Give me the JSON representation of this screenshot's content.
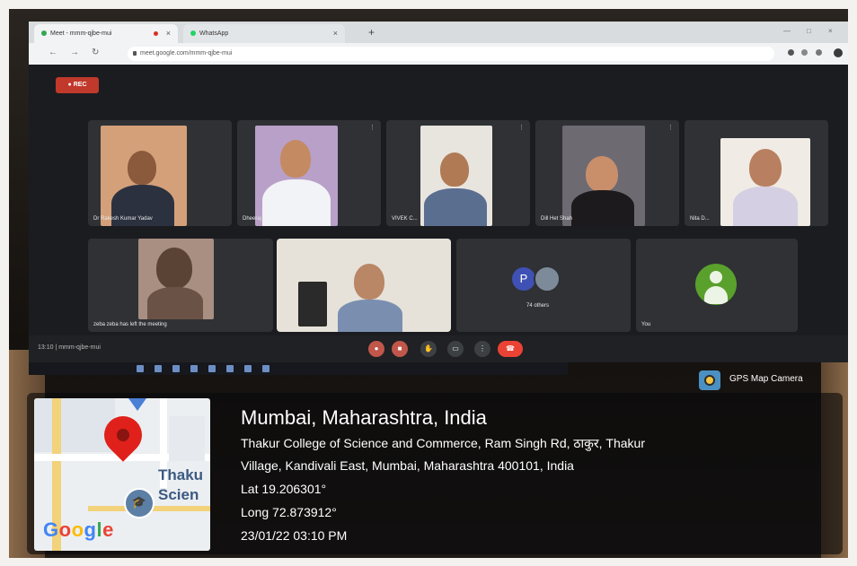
{
  "browser": {
    "tabs": [
      {
        "label": "Meet - mmm-qjbe-mui"
      },
      {
        "label": "WhatsApp"
      }
    ],
    "new_tab": "+",
    "url": "meet.google.com/mmm-qjbe-mui"
  },
  "meet": {
    "rec_label": "REC",
    "row1": [
      {
        "name": "Dr Rakesh Kumar Yadav"
      },
      {
        "name": "Dheeraj"
      },
      {
        "name": "VIVEK C..."
      },
      {
        "name": "Dill Het Shah"
      },
      {
        "name": "Nita D..."
      }
    ],
    "row2": [
      {
        "name": "zeba zeba has left the meeting"
      },
      {
        "name": ""
      },
      {
        "name": "74 others",
        "avatar_letter": "P"
      },
      {
        "name": "You"
      }
    ],
    "meeting_code": "13:10  |  mmm-qjbe-mui"
  },
  "gps_camera": {
    "label": "GPS Map Camera"
  },
  "location": {
    "title": "Mumbai, Maharashtra, India",
    "address_line1": "Thakur College of Science and Commerce, Ram Singh Rd, ठाकुर, Thakur",
    "address_line2": "Village, Kandivali East, Mumbai, Maharashtra 400101, India",
    "lat": "Lat 19.206301°",
    "long": "Long 72.873912°",
    "datetime": "23/01/22 03:10 PM"
  },
  "map": {
    "label_line1": "Thaku",
    "label_line2": "Scien",
    "brand": {
      "G": "G",
      "o1": "o",
      "o2": "o",
      "g": "g",
      "l": "l",
      "e": "e"
    }
  },
  "colors": {
    "rec": "#c0392b",
    "pin": "#e0201a",
    "avatar_p": "#3f51b5",
    "you_avatar": "#5aa02c"
  }
}
